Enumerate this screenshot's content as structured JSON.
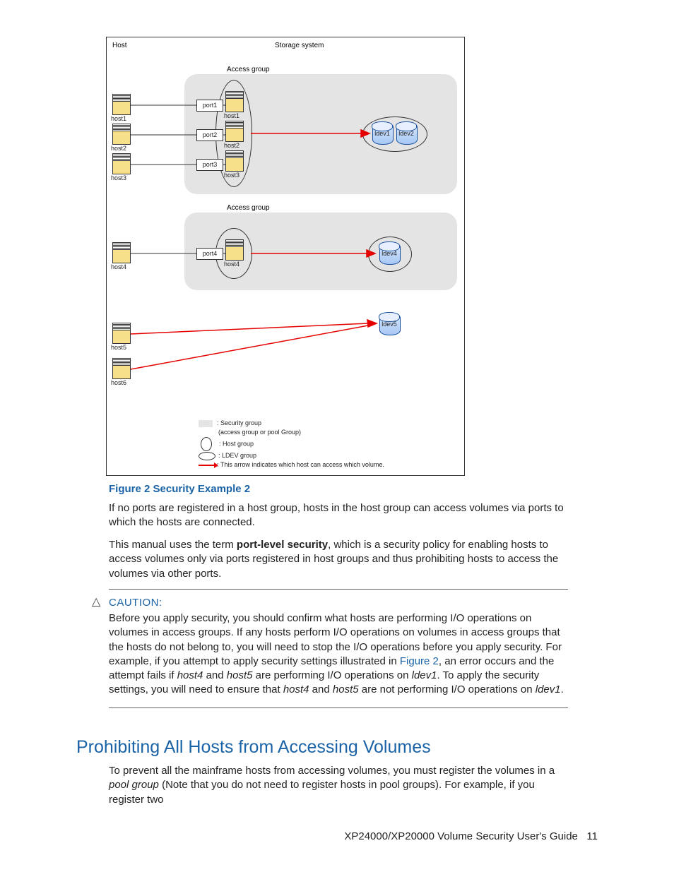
{
  "diagram": {
    "header_host": "Host",
    "header_storage": "Storage system",
    "access_group_1": "Access group",
    "access_group_2": "Access group",
    "hosts_left": [
      "host1",
      "host2",
      "host3",
      "host4",
      "host5",
      "host6"
    ],
    "hosts_inner": [
      "host1",
      "host2",
      "host3",
      "host4"
    ],
    "ports": [
      "port1",
      "port2",
      "port3",
      "port4"
    ],
    "ldevs": [
      "ldev1",
      "ldev2",
      "ldev4",
      "ldev5"
    ],
    "legend": {
      "security": ": Security group",
      "security_sub": "(access group or pool Group)",
      "host": ": Host group",
      "ldev": ": LDEV group",
      "arrow": ": This arrow indicates which host can access which volume."
    }
  },
  "figure_caption": "Figure 2 Security Example 2",
  "para1_a": "If no ports are registered in a host group, hosts in the host group can access volumes via ports to which the hosts are connected.",
  "para2_a": "This manual uses the term ",
  "para2_bold": "port-level security",
  "para2_b": ", which is a security policy for enabling hosts to access volumes only via ports registered in host groups and thus prohibiting hosts to access the volumes via other ports.",
  "caution": {
    "label": "CAUTION:",
    "t1": "Before you apply security, you should confirm what hosts are performing I/O operations on volumes in access groups. If any hosts perform I/O operations on volumes in access groups that the hosts do not belong to, you will need to stop the I/O operations before you apply security. For example, if you attempt to apply security settings illustrated in ",
    "link": "Figure 2",
    "t2": ", an error occurs and the attempt fails if ",
    "i1": "host4",
    "t3": " and ",
    "i2": "host5",
    "t4": " are performing I/O operations on ",
    "i3": "ldev1",
    "t5": ". To apply the security settings, you will need to ensure that ",
    "i4": "host4",
    "t6": " and ",
    "i5": "host5",
    "t7": " are not performing I/O operations on ",
    "i6": "ldev1",
    "t8": "."
  },
  "section_heading": "Prohibiting All Hosts from Accessing Volumes",
  "sec_para_a": "To prevent all the mainframe hosts from accessing volumes, you must register the volumes in a ",
  "sec_para_i": "pool group",
  "sec_para_b": " (Note that you do not need to register hosts in pool groups). For example, if you register two",
  "footer_title": "XP24000/XP20000 Volume Security User's Guide",
  "footer_page": "11"
}
